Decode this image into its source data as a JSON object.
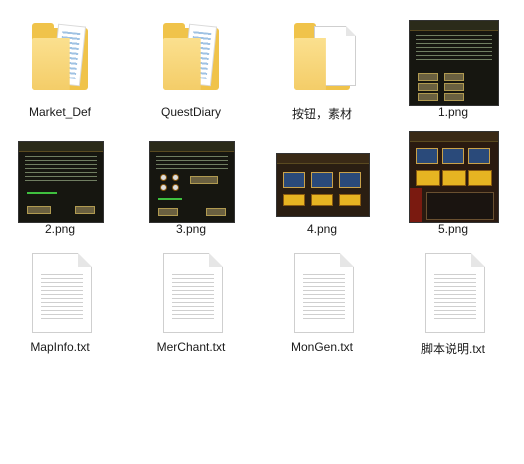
{
  "files": [
    {
      "name": "Market_Def",
      "kind": "folder"
    },
    {
      "name": "QuestDiary",
      "kind": "folder"
    },
    {
      "name": "按钮，素材",
      "kind": "folder-empty"
    },
    {
      "name": "1.png",
      "kind": "image"
    },
    {
      "name": "2.png",
      "kind": "image"
    },
    {
      "name": "3.png",
      "kind": "image"
    },
    {
      "name": "4.png",
      "kind": "image"
    },
    {
      "name": "5.png",
      "kind": "image"
    },
    {
      "name": "MapInfo.txt",
      "kind": "text"
    },
    {
      "name": "MerChant.txt",
      "kind": "text"
    },
    {
      "name": "MonGen.txt",
      "kind": "text"
    },
    {
      "name": "脚本说明.txt",
      "kind": "text"
    }
  ],
  "icons": {
    "folder": "folder-icon",
    "image": "image-thumbnail-icon",
    "text": "text-file-icon"
  },
  "colors": {
    "folder": "#f0c34a",
    "text_label": "#1a1a1a",
    "background": "#ffffff"
  }
}
